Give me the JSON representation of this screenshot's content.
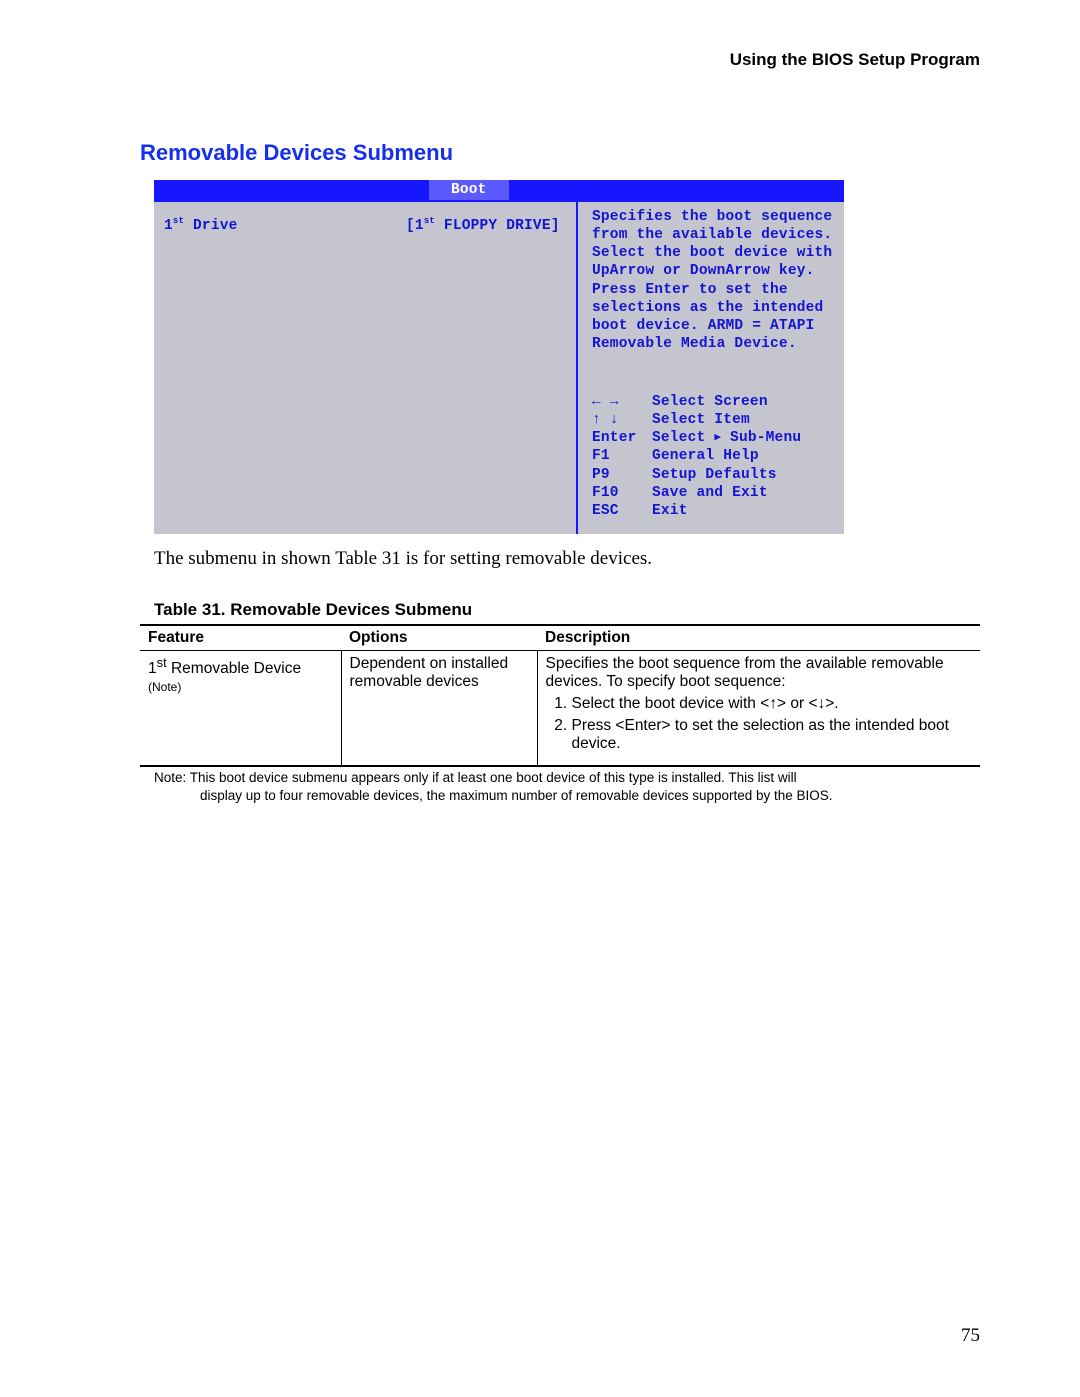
{
  "header": {
    "running": "Using the BIOS Setup Program"
  },
  "section": {
    "title": "Removable Devices Submenu"
  },
  "bios": {
    "tab": "Boot",
    "drive_label_pre": "1",
    "drive_label_sup": "st",
    "drive_label_post": " Drive",
    "floppy_pre": "[1",
    "floppy_sup": "st",
    "floppy_post": " FLOPPY DRIVE]",
    "help": "Specifies the boot sequence from the available devices.  Select the boot device with UpArrow or DownArrow key.  Press Enter to set the selections as the intended boot device.  ARMD = ATAPI Removable Media Device.",
    "nav": [
      {
        "key": "← →",
        "action": "Select Screen"
      },
      {
        "key": "↑ ↓",
        "action": "Select Item"
      },
      {
        "key": "Enter",
        "action": "Select ▸ Sub-Menu"
      },
      {
        "key": "F1",
        "action": "General Help"
      },
      {
        "key": "P9",
        "action": "Setup Defaults"
      },
      {
        "key": "F10",
        "action": "Save and Exit"
      },
      {
        "key": "ESC",
        "action": "Exit"
      }
    ]
  },
  "paragraph": "The submenu in shown Table 31 is for setting removable devices.",
  "table": {
    "caption": "Table 31.    Removable Devices Submenu",
    "headers": {
      "feature": "Feature",
      "options": "Options",
      "description": "Description"
    },
    "row": {
      "feature_pre": "1",
      "feature_sup": "st",
      "feature_post": " Removable Device",
      "feature_note": "(Note)",
      "options": "Dependent on installed removable devices",
      "desc_intro": "Specifies the boot sequence from the available removable devices.  To specify boot sequence:",
      "steps": [
        "Select the boot device with <↑> or <↓>.",
        "Press <Enter> to set the selection as the intended boot device."
      ]
    }
  },
  "note": {
    "line1": "Note:  This boot device submenu appears only if at least one boot device of this type is installed.  This list will",
    "line2": "display up to four removable devices, the maximum number of removable devices supported by the BIOS."
  },
  "page_number": "75"
}
